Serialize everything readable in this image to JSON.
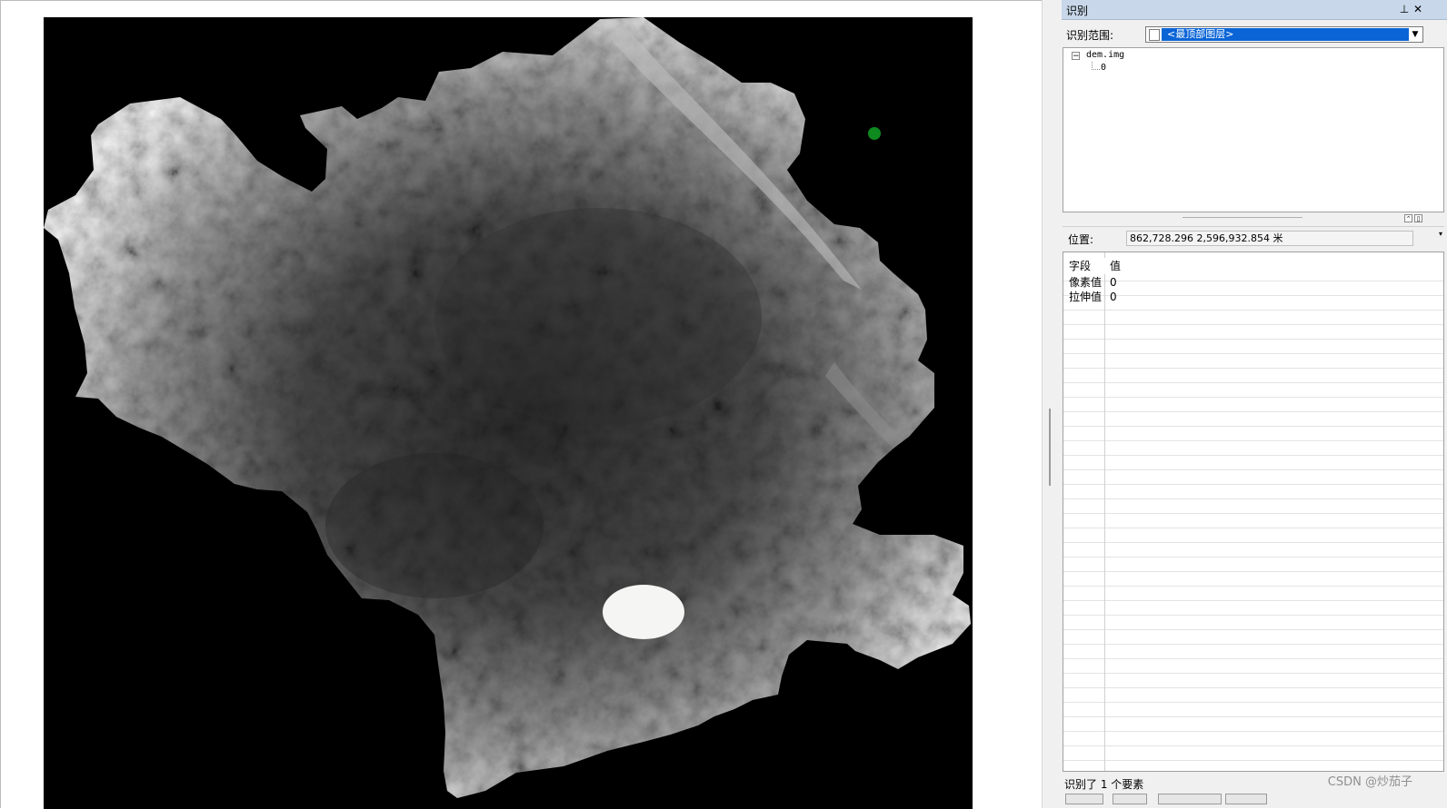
{
  "panel": {
    "title": "识别",
    "pin_icon": "pin-icon",
    "close_icon": "close-icon"
  },
  "scope": {
    "label": "识别范围:",
    "selected": "<最顶部图层>"
  },
  "tree": {
    "root": "dem.img",
    "child": "0"
  },
  "location": {
    "label": "位置:",
    "value": "862,728.296  2,596,932.854 米"
  },
  "grid": {
    "headers": [
      "字段",
      "值"
    ],
    "rows": [
      {
        "field": "像素值",
        "value": "0"
      },
      {
        "field": "拉伸值",
        "value": "0"
      }
    ]
  },
  "status": {
    "text": "识别了 1 个要素"
  },
  "watermark": "CSDN @炒茄子",
  "colors": {
    "title_bar": "#c8d7e9",
    "selection": "#0a64d6",
    "marker": "#0e8a1e",
    "map_background": "#000000"
  }
}
